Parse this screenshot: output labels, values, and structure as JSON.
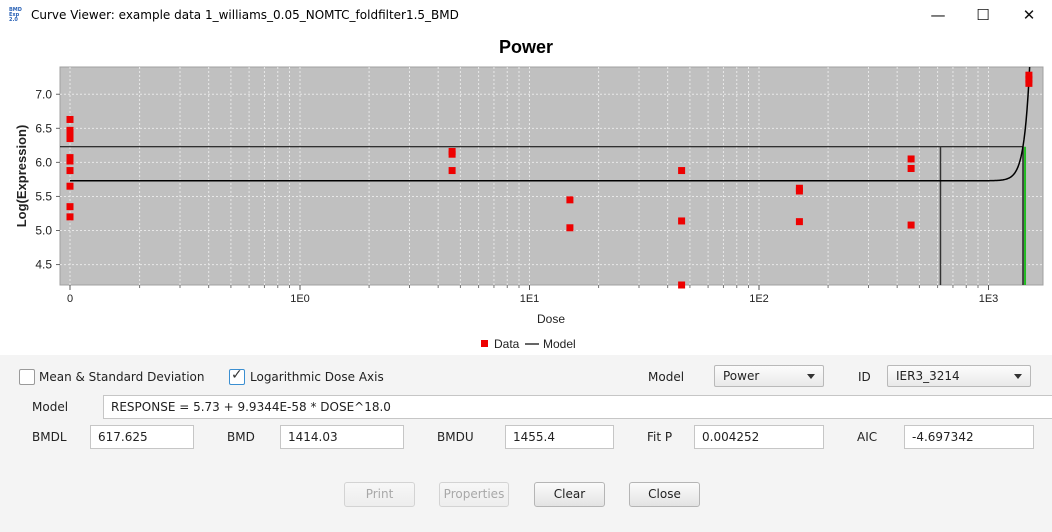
{
  "window": {
    "title": "Curve Viewer: example data 1_williams_0.05_NOMTC_foldfilter1.5_BMD",
    "app_icon_text": "BMD Express 2.0",
    "minimize_icon": "minimize-icon",
    "maximize_icon": "maximize-icon",
    "close_icon": "close-icon"
  },
  "chart_data": {
    "type": "scatter",
    "title": "Power",
    "xlabel": "Dose",
    "ylabel": "Log(Expression)",
    "x_scale": "log",
    "x_tick_labels": [
      "0",
      "1E0",
      "1E1",
      "1E2",
      "1E3"
    ],
    "y_ticks": [
      4.5,
      5.0,
      5.5,
      6.0,
      6.5,
      7.0
    ],
    "y_tick_labels": [
      "4.5",
      "5.0",
      "5.5",
      "6.0",
      "6.5",
      "7.0"
    ],
    "ylim": [
      4.2,
      7.4
    ],
    "grid": true,
    "legend": {
      "position": "bottom",
      "entries": [
        "Data",
        "Model"
      ]
    },
    "colors": {
      "data": "#ee0000",
      "model": "#000000",
      "bmd_line": "#22bb22",
      "plot_bg": "#c0c0c0"
    },
    "series": [
      {
        "name": "Data",
        "points": [
          {
            "x": 0,
            "y": 6.63
          },
          {
            "x": 0,
            "y": 6.47
          },
          {
            "x": 0,
            "y": 6.42
          },
          {
            "x": 0,
            "y": 6.35
          },
          {
            "x": 0,
            "y": 6.07
          },
          {
            "x": 0,
            "y": 6.02
          },
          {
            "x": 0,
            "y": 5.88
          },
          {
            "x": 0,
            "y": 5.65
          },
          {
            "x": 0,
            "y": 5.35
          },
          {
            "x": 0,
            "y": 5.2
          },
          {
            "x": 4.6,
            "y": 6.16
          },
          {
            "x": 4.6,
            "y": 6.12
          },
          {
            "x": 4.6,
            "y": 5.88
          },
          {
            "x": 15,
            "y": 5.45
          },
          {
            "x": 15,
            "y": 5.04
          },
          {
            "x": 46,
            "y": 5.88
          },
          {
            "x": 46,
            "y": 5.14
          },
          {
            "x": 46,
            "y": 4.2
          },
          {
            "x": 150,
            "y": 5.62
          },
          {
            "x": 150,
            "y": 5.58
          },
          {
            "x": 150,
            "y": 5.13
          },
          {
            "x": 460,
            "y": 6.05
          },
          {
            "x": 460,
            "y": 5.91
          },
          {
            "x": 460,
            "y": 5.08
          },
          {
            "x": 1500,
            "y": 7.28
          },
          {
            "x": 1500,
            "y": 7.22
          },
          {
            "x": 1500,
            "y": 7.16
          }
        ]
      },
      {
        "name": "Model",
        "equation": {
          "intercept": 5.73,
          "coefficient": 9.9344e-58,
          "power": 18.0
        }
      }
    ],
    "reference_lines": {
      "upper_response": 6.23,
      "bmdl": 617.625,
      "bmd": 1414.03
    }
  },
  "controls": {
    "mean_sd": {
      "label": "Mean & Standard Deviation",
      "checked": false
    },
    "log_axis": {
      "label": "Logarithmic Dose Axis",
      "checked": true
    },
    "model_select": {
      "label": "Model",
      "value": "Power"
    },
    "id_select": {
      "label": "ID",
      "value": "IER3_3214"
    },
    "model_equation": {
      "label": "Model",
      "value": "RESPONSE = 5.73 + 9.9344E-58 * DOSE^18.0"
    },
    "fields": [
      {
        "label": "BMDL",
        "value": "617.625"
      },
      {
        "label": "BMD",
        "value": "1414.03"
      },
      {
        "label": "BMDU",
        "value": "1455.4"
      },
      {
        "label": "Fit P",
        "value": "0.004252"
      },
      {
        "label": "AIC",
        "value": "-4.697342"
      }
    ],
    "buttons": {
      "print": "Print",
      "properties": "Properties",
      "clear": "Clear",
      "close": "Close"
    }
  }
}
